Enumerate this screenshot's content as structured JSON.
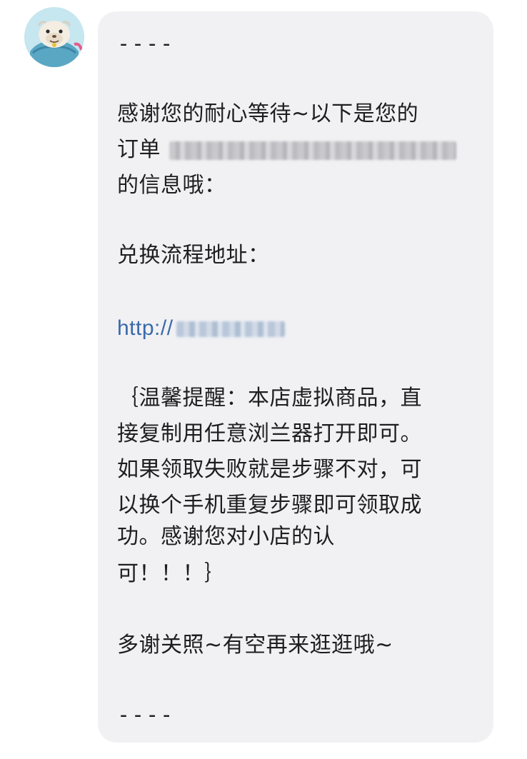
{
  "message": {
    "line_01": "----",
    "line_02": "感谢您的耐心等待~以下是您的",
    "line_03_prefix": "订单",
    "line_04": "的信息哦：",
    "line_05": "兑换流程地址：",
    "link_prefix": "http://",
    "line_06": "｛温馨提醒：本店虚拟商品，直",
    "line_07": "接复制用任意浏兰器打开即可。",
    "line_08": "如果领取失败就是步骤不对，可",
    "line_09": "以换个手机重复步骤即可领取成",
    "line_10": "功。感谢您对小店的认",
    "line_11": "可！！！｝",
    "line_12": "多谢关照~有空再来逛逛哦~",
    "line_13": "----"
  },
  "colors": {
    "bubble_bg": "#f1f1f4",
    "text": "#1e1e1e",
    "link": "#3a6aa8"
  },
  "icons": {
    "avatar": "seal-astronaut-avatar"
  }
}
